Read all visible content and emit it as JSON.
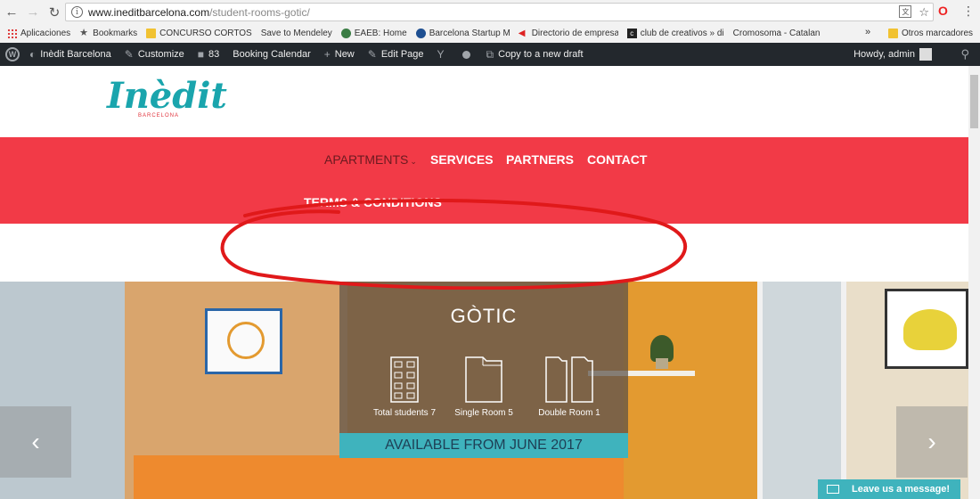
{
  "browser": {
    "url_host": "www.ineditbarcelona.com",
    "url_path": "/student-rooms-gotic/",
    "bookmarks": [
      {
        "label": "Aplicaciones",
        "icon": "apps-grid-icon"
      },
      {
        "label": "Bookmarks",
        "icon": "star-icon"
      },
      {
        "label": "CONCURSO CORTOS",
        "icon": "folder-icon"
      },
      {
        "label": "Save to Mendeley",
        "icon": "page-icon"
      },
      {
        "label": "EAEB: Home",
        "icon": "eaeb-icon"
      },
      {
        "label": "Barcelona Startup Ma",
        "icon": "startup-icon"
      },
      {
        "label": "Directorio de empresa",
        "icon": "directorio-icon"
      },
      {
        "label": "club de creativos » di",
        "icon": "club-icon"
      },
      {
        "label": "Cromosoma - Catalan",
        "icon": "page-icon"
      }
    ],
    "bookmarks_more": "»",
    "bookmarks_other": "Otros marcadores"
  },
  "admin_bar": {
    "site_name": "Inèdit Barcelona",
    "customize": "Customize",
    "comments_count": "83",
    "booking_calendar": "Booking Calendar",
    "new": "New",
    "edit_page": "Edit Page",
    "copy_draft": "Copy to a new draft",
    "howdy": "Howdy, admin"
  },
  "site": {
    "logo_text": "Inèdit",
    "logo_sub": "BARCELONA",
    "nav": {
      "apartments": "APARTMENTS",
      "services": "SERVICES",
      "partners": "PARTNERS",
      "contact": "CONTACT",
      "terms": "TERMS & CONDITIONS"
    }
  },
  "hero": {
    "title": "GÒTIC",
    "stats": [
      {
        "label": "Total students 7",
        "icon": "building-icon"
      },
      {
        "label": "Single Room 5",
        "icon": "single-room-icon"
      },
      {
        "label": "Double Room 1",
        "icon": "double-room-icon"
      }
    ],
    "cta": "AVAILABLE FROM JUNE 2017"
  },
  "chat": {
    "label": "Leave us a message!"
  },
  "colors": {
    "nav_bg": "#f23a47",
    "teal": "#3fb3bd",
    "admin_bar": "#23282d"
  }
}
